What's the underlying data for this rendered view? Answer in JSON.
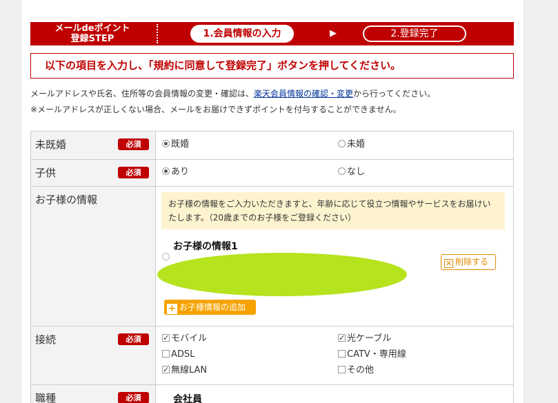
{
  "step": {
    "title_line1": "メールdeポイント",
    "title_line2": "登録STEP",
    "step1": "1.会員情報の入力",
    "arrow": "▶",
    "step2": "2.登録完了"
  },
  "notice": "以下の項目を入力し、「規約に同意して登録完了」ボタンを押してください。",
  "info": {
    "line1_pre": "メールアドレスや氏名、住所等の会員情報の変更・確認は、",
    "line1_link": "楽天会員情報の確認・変更",
    "line1_post": "から行ってください。",
    "line2": "※メールアドレスが正しくない場合、メールをお届けできずポイントを付与することができません。"
  },
  "required_label": "必須",
  "form": {
    "marital": {
      "label": "未既婚",
      "opt1": "既婚",
      "opt2": "未婚"
    },
    "children": {
      "label": "子供",
      "opt1": "あり",
      "opt2": "なし"
    },
    "child_info": {
      "label": "お子様の情報",
      "notice": "お子様の情報をご入力いただきますと、年齢に応じて役立つ情報やサービスをお届けいたします。（20歳までのお子様をご登録ください）",
      "entry_title": "お子様の情報1",
      "delete_label": "削除する",
      "add_label": "お子様情報の追加"
    },
    "connection": {
      "label": "接続",
      "opt_mobile": "モバイル",
      "opt_cable": "光ケーブル",
      "opt_adsl": "ADSL",
      "opt_catv": "CATV・専用線",
      "opt_wlan": "無線LAN",
      "opt_other": "その他"
    },
    "occupation": {
      "label": "職種",
      "value": "会社員"
    }
  }
}
